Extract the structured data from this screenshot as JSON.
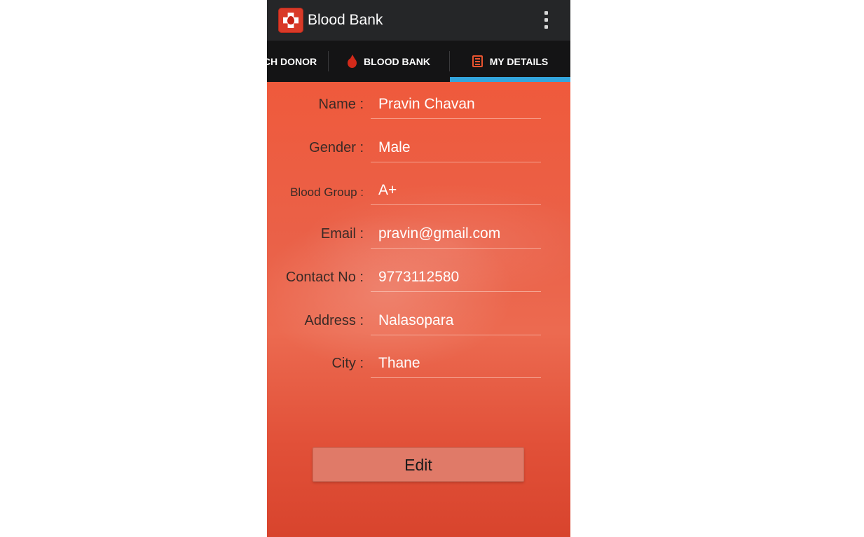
{
  "app": {
    "title": "Blood Bank",
    "icon": "blood-bank-app-icon",
    "menu_icon": "overflow-menu-icon"
  },
  "tabs": [
    {
      "label": "CH DONOR",
      "icon": null,
      "selected": false
    },
    {
      "label": "BLOOD BANK",
      "icon": "blood-drop-icon",
      "selected": false
    },
    {
      "label": "MY DETAILS",
      "icon": "details-list-icon",
      "selected": true
    }
  ],
  "details": {
    "name": {
      "label": "Name :",
      "value": "Pravin Chavan"
    },
    "gender": {
      "label": "Gender :",
      "value": "Male"
    },
    "blood_group": {
      "label": "Blood Group :",
      "value": "A+"
    },
    "email": {
      "label": "Email :",
      "value": "pravin@gmail.com"
    },
    "contact": {
      "label": "Contact No :",
      "value": "9773112580"
    },
    "address": {
      "label": "Address :",
      "value": "Nalasopara"
    },
    "city": {
      "label": "City :",
      "value": "Thane"
    }
  },
  "edit_button": {
    "label": "Edit"
  },
  "colors": {
    "action_bar": "#252628",
    "tab_bar": "#141415",
    "tab_indicator": "#33a5dc",
    "background": "#e9583f",
    "accent": "#d32a1a"
  }
}
